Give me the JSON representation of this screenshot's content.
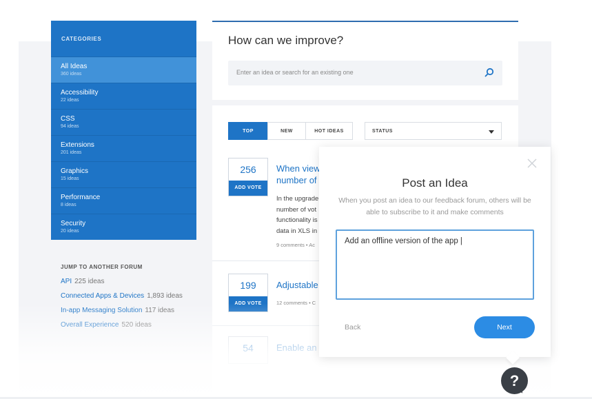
{
  "sidebar": {
    "title": "CATEGORIES",
    "items": [
      {
        "label": "All Ideas",
        "count": "360 ideas"
      },
      {
        "label": "Accessibility",
        "count": "22 ideas"
      },
      {
        "label": "CSS",
        "count": "94 ideas"
      },
      {
        "label": "Extensions",
        "count": "201 ideas"
      },
      {
        "label": "Graphics",
        "count": "15 ideas"
      },
      {
        "label": "Performance",
        "count": "8 ideas"
      },
      {
        "label": "Security",
        "count": "20 ideas"
      }
    ]
  },
  "forums": {
    "title": "JUMP TO ANOTHER FORUM",
    "items": [
      {
        "label": "API",
        "count": "225 ideas"
      },
      {
        "label": "Connected Apps & Devices",
        "count": "1,893 ideas"
      },
      {
        "label": "In-app Messaging Solution",
        "count": "117 ideas"
      },
      {
        "label": "Overall Experience",
        "count": "520 ideas"
      }
    ]
  },
  "main": {
    "heading": "How can we improve?",
    "search_placeholder": "Enter an idea or search for an existing one"
  },
  "tabs": [
    "TOP",
    "NEW",
    "HOT IDEAS"
  ],
  "status_label": "STATUS",
  "ideas": [
    {
      "votes": "256",
      "vote_label": "ADD VOTE",
      "title_line1": "When view",
      "title_line2": "number of",
      "body": [
        "In the upgrade",
        "number of vot",
        "functionality is",
        "data in XLS in"
      ],
      "meta": "9 comments • Ac"
    },
    {
      "votes": "199",
      "vote_label": "ADD VOTE",
      "title_line1": "Adjustable",
      "meta": "12 comments • C"
    },
    {
      "votes": "54",
      "title_line1": "Enable an"
    }
  ],
  "modal": {
    "title": "Post an Idea",
    "subtitle": "When you post an idea to our feedback forum, others will be able to subscribe to it and make comments",
    "input_value": "Add an offline version of the app |",
    "back_label": "Back",
    "next_label": "Next"
  },
  "help_label": "?",
  "colors": {
    "brand": "#1e74c6",
    "active_item": "#4192d9",
    "next_button": "#2c8ce4"
  }
}
